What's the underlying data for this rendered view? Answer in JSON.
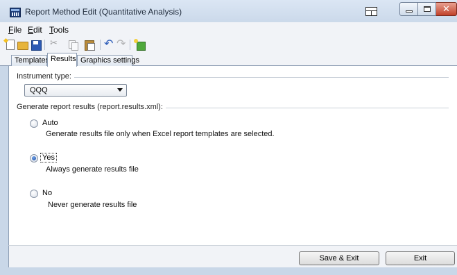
{
  "window": {
    "title": "Report Method Edit (Quantitative Analysis)"
  },
  "menu": [
    {
      "label": "File",
      "accel": "F",
      "rest": "ile"
    },
    {
      "label": "Edit",
      "accel": "E",
      "rest": "dit"
    },
    {
      "label": "Tools",
      "accel": "T",
      "rest": "ools"
    }
  ],
  "toolbar": {
    "icons": [
      "new-icon",
      "open-icon",
      "save-icon",
      "cut-icon",
      "copy-icon",
      "paste-icon",
      "undo-icon",
      "redo-icon",
      "export-icon"
    ]
  },
  "tabs": [
    {
      "label": "Templates",
      "selected": false
    },
    {
      "label": "Results",
      "selected": true
    },
    {
      "label": "Graphics settings",
      "selected": false
    }
  ],
  "instrument": {
    "label": "Instrument type:",
    "value": "QQQ"
  },
  "results_group": {
    "label": "Generate report results (report.results.xml):",
    "options": [
      {
        "label": "Auto",
        "description": "Generate results file only when Excel report templates are selected.",
        "checked": false
      },
      {
        "label": "Yes",
        "description": "Always generate results file",
        "checked": true
      },
      {
        "label": "No",
        "description": "Never generate results file",
        "checked": false
      }
    ]
  },
  "buttons": {
    "save_exit": "Save & Exit",
    "exit": "Exit"
  },
  "colors": {
    "accent": "#1c4ea5",
    "window_frame": "#c9d7e8",
    "close_button": "#c1412a"
  }
}
